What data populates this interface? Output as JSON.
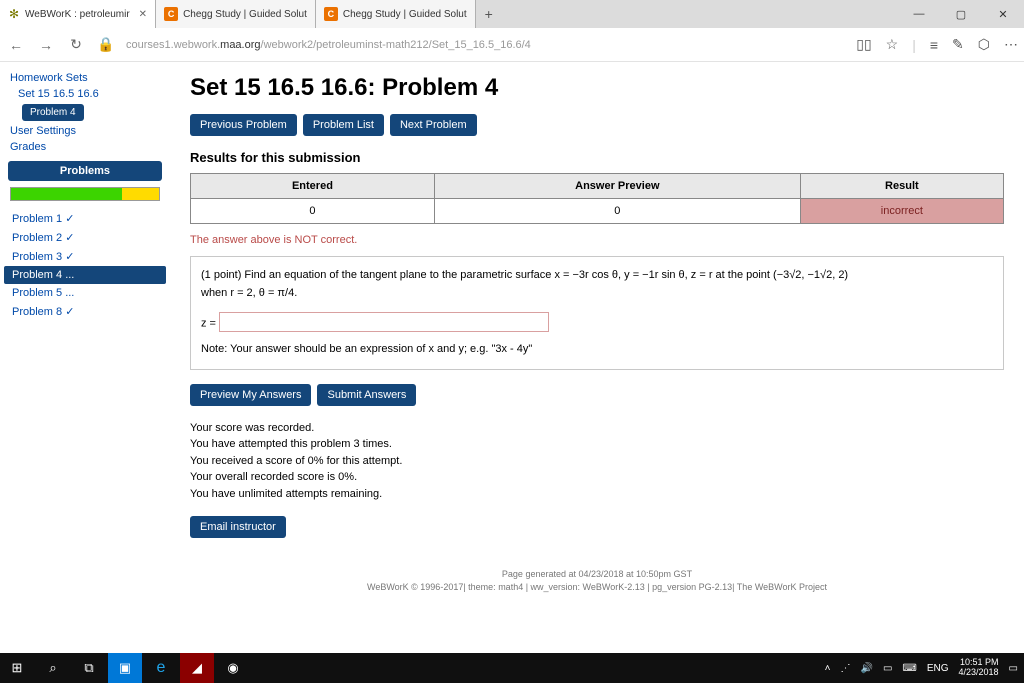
{
  "window": {
    "tabs": [
      {
        "label": "WeBWorK : petroleumir",
        "icon": "✻"
      },
      {
        "label": "Chegg Study | Guided Solut",
        "icon": "C"
      },
      {
        "label": "Chegg Study | Guided Solut",
        "icon": "C"
      }
    ],
    "controls": {
      "min": "—",
      "max": "▢",
      "close": "✕"
    }
  },
  "address": {
    "url_prefix": "courses1.webwork.",
    "url_host": "maa.org",
    "url_path": "/webwork2/petroleuminst-math212/Set_15_16.5_16.6/4"
  },
  "sidebar": {
    "homework_sets": "Homework Sets",
    "set_link": "Set 15 16.5 16.6",
    "problem_pill": "Problem 4",
    "user_settings": "User Settings",
    "grades": "Grades",
    "problems_hdr": "Problems",
    "items": [
      {
        "label": "Problem 1 ✓",
        "sel": false
      },
      {
        "label": "Problem 2 ✓",
        "sel": false
      },
      {
        "label": "Problem 3 ✓",
        "sel": false
      },
      {
        "label": "Problem 4 ...",
        "sel": true
      },
      {
        "label": "Problem 5 ...",
        "sel": false
      },
      {
        "label": "Problem 8 ✓",
        "sel": false
      }
    ]
  },
  "main": {
    "title": "Set 15 16.5 16.6: Problem 4",
    "nav": {
      "prev": "Previous Problem",
      "list": "Problem List",
      "next": "Next Problem"
    },
    "results_hdr": "Results for this submission",
    "table": {
      "h1": "Entered",
      "h2": "Answer Preview",
      "h3": "Result",
      "c1": "0",
      "c2": "0",
      "c3": "incorrect"
    },
    "wrong": "The answer above is NOT correct.",
    "problem": {
      "text1": "(1 point) Find an equation of the tangent plane to the parametric surface x = −3r cos θ, y = −1r sin θ, z = r at the point (−3√2, −1√2, 2)",
      "text2": "when r = 2, θ = π/4.",
      "zlabel": "z =",
      "note": "Note: Your answer should be an expression of x and y; e.g. \"3x - 4y\""
    },
    "actions": {
      "preview": "Preview My Answers",
      "submit": "Submit Answers",
      "email": "Email instructor"
    },
    "score": {
      "l1": "Your score was recorded.",
      "l2": "You have attempted this problem 3 times.",
      "l3": "You received a score of 0% for this attempt.",
      "l4": "Your overall recorded score is 0%.",
      "l5": "You have unlimited attempts remaining."
    },
    "footer": {
      "l1": "Page generated at 04/23/2018 at 10:50pm GST",
      "l2": "WeBWorK © 1996-2017| theme: math4 | ww_version: WeBWorK-2.13 | pg_version PG-2.13| The WeBWorK Project"
    }
  },
  "taskbar": {
    "lang": "ENG",
    "time": "10:51 PM",
    "date": "4/23/2018"
  }
}
